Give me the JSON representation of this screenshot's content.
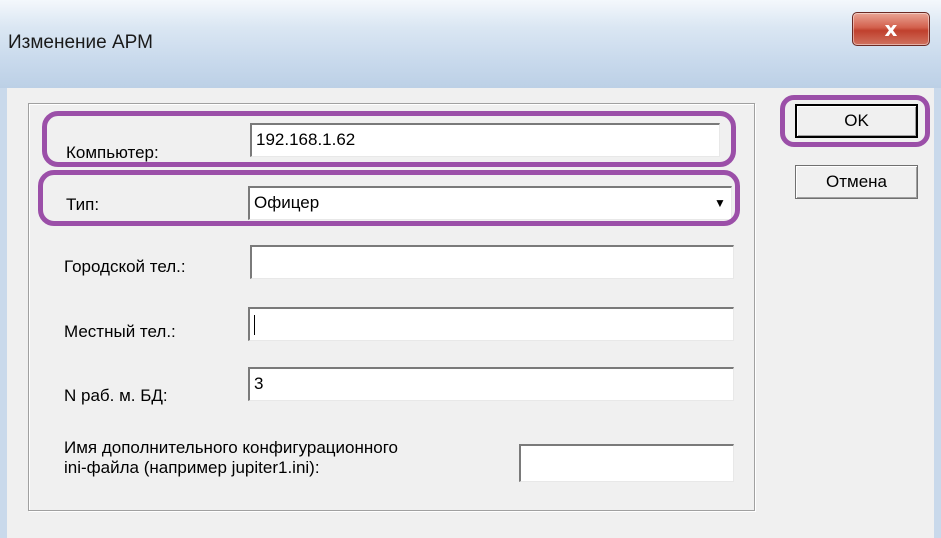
{
  "window": {
    "title": "Изменение АРМ",
    "close_glyph": "x"
  },
  "form": {
    "computer_label": "Компьютер:",
    "computer_value": "192.168.1.62",
    "type_label": "Тип:",
    "type_value": "Офицер",
    "city_phone_label": "Городской тел.:",
    "city_phone_value": "",
    "local_phone_label": "Местный тел.:",
    "local_phone_value": "",
    "db_workstation_label": "N раб. м. БД:",
    "db_workstation_value": "3",
    "ini_label_line1": "Имя дополнительного конфигурационного",
    "ini_label_line2": "ini-файла (например jupiter1.ini):",
    "ini_value": ""
  },
  "buttons": {
    "ok_label": "OK",
    "cancel_label": "Отмена"
  },
  "colors": {
    "highlight": "#9b4fa8",
    "close_button": "#c8533f",
    "titlebar": "#c8d9ec"
  }
}
